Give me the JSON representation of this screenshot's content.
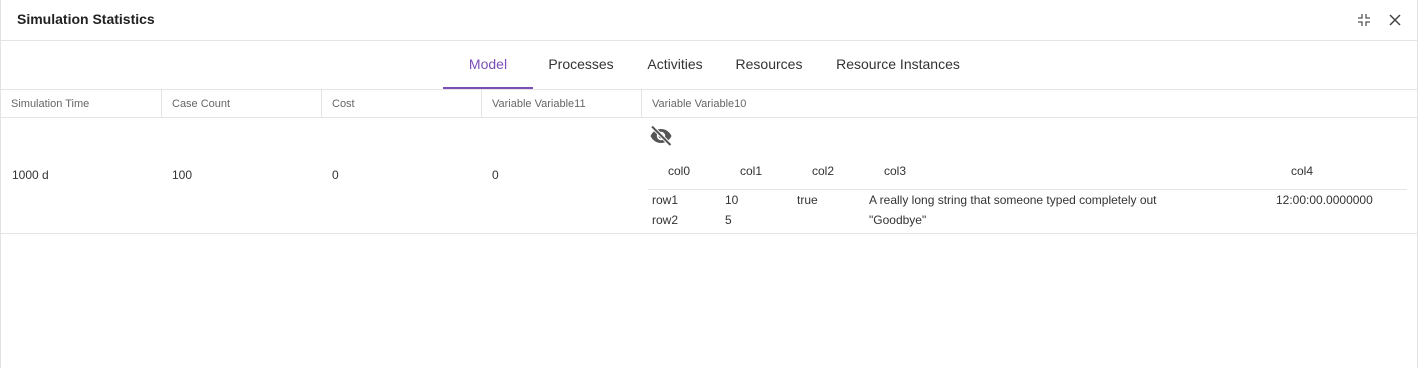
{
  "window": {
    "title": "Simulation Statistics"
  },
  "tabs": [
    {
      "label": "Model",
      "active": true
    },
    {
      "label": "Processes",
      "active": false
    },
    {
      "label": "Activities",
      "active": false
    },
    {
      "label": "Resources",
      "active": false
    },
    {
      "label": "Resource Instances",
      "active": false
    }
  ],
  "table": {
    "headers": [
      "Simulation Time",
      "Case Count",
      "Cost",
      "Variable Variable11",
      "Variable Variable10"
    ],
    "row": [
      "1000 d",
      "100",
      "0",
      "0"
    ]
  },
  "nested": {
    "visibility_icon": "eye-off-icon",
    "headers": [
      "col0",
      "col1",
      "col2",
      "col3",
      "col4"
    ],
    "rows": [
      [
        "row1",
        "10",
        "true",
        "A really long string that someone typed completely out",
        "12:00:00.0000000"
      ],
      [
        "row2",
        "5",
        "",
        "\"Goodbye\"",
        ""
      ]
    ]
  },
  "icons": {
    "minimize": "collapse-icon",
    "close": "close-icon"
  },
  "colors": {
    "accent": "#7b4fb5",
    "border": "#e4e4e4",
    "icon": "#555555"
  }
}
